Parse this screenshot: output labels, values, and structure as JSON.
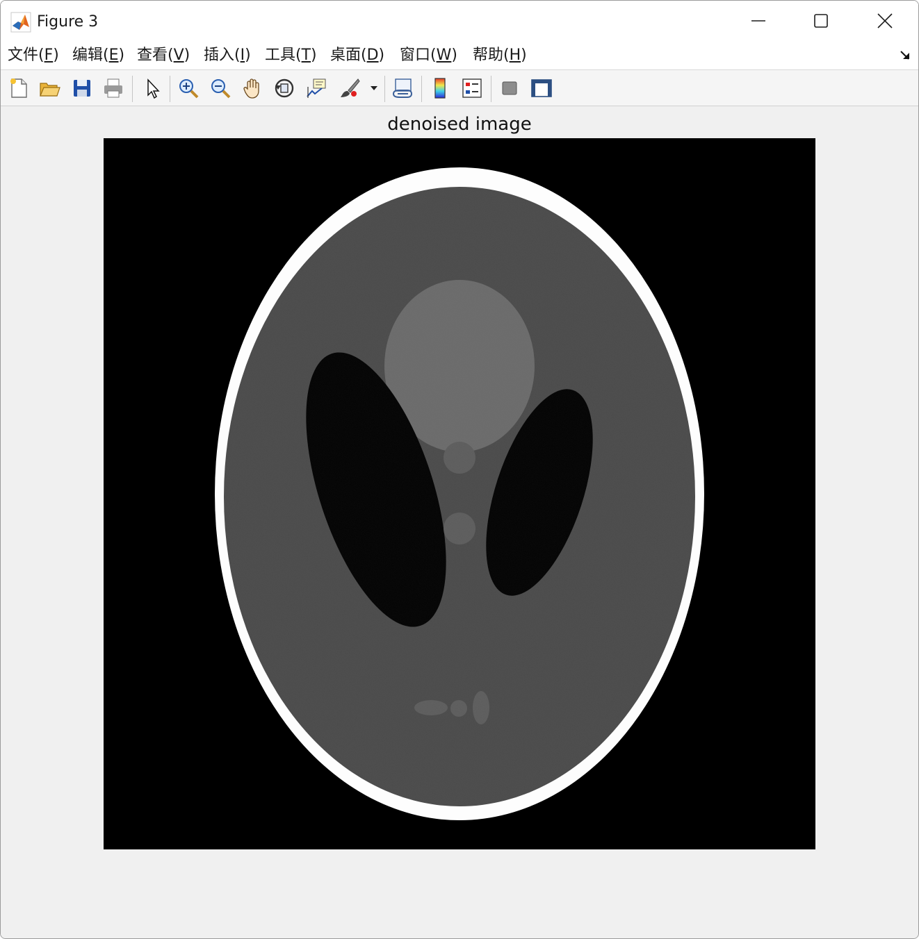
{
  "window": {
    "title": "Figure 3",
    "app_icon": "matlab-logo-icon",
    "controls": [
      "minimize-icon",
      "maximize-icon",
      "close-icon"
    ]
  },
  "menu": {
    "items": [
      {
        "label": "文件(",
        "key": "F",
        "tail": ")"
      },
      {
        "label": "编辑(",
        "key": "E",
        "tail": ")"
      },
      {
        "label": "查看(",
        "key": "V",
        "tail": ")"
      },
      {
        "label": "插入(",
        "key": "I",
        "tail": ")"
      },
      {
        "label": "工具(",
        "key": "T",
        "tail": ")"
      },
      {
        "label": "桌面(",
        "key": "D",
        "tail": ")"
      },
      {
        "label": "窗口(",
        "key": "W",
        "tail": ")"
      },
      {
        "label": "帮助(",
        "key": "H",
        "tail": ")"
      }
    ],
    "dock_icon": "dock-arrow-icon"
  },
  "toolbar": {
    "icons": [
      "new-figure-icon",
      "open-file-icon",
      "save-icon",
      "print-icon",
      "edit-plot-icon",
      "zoom-in-icon",
      "zoom-out-icon",
      "pan-icon",
      "rotate-3d-icon",
      "data-cursor-icon",
      "brush-icon",
      "link-plot-icon",
      "insert-colorbar-icon",
      "insert-legend-icon",
      "hide-plot-tools-icon",
      "show-plot-tools-icon"
    ]
  },
  "axes": {
    "title": "denoised image",
    "image": "shepp-logan-phantom"
  },
  "colors": {
    "background": "#f0f0f0",
    "image_background": "#000000",
    "titlebar": "#ffffff"
  }
}
